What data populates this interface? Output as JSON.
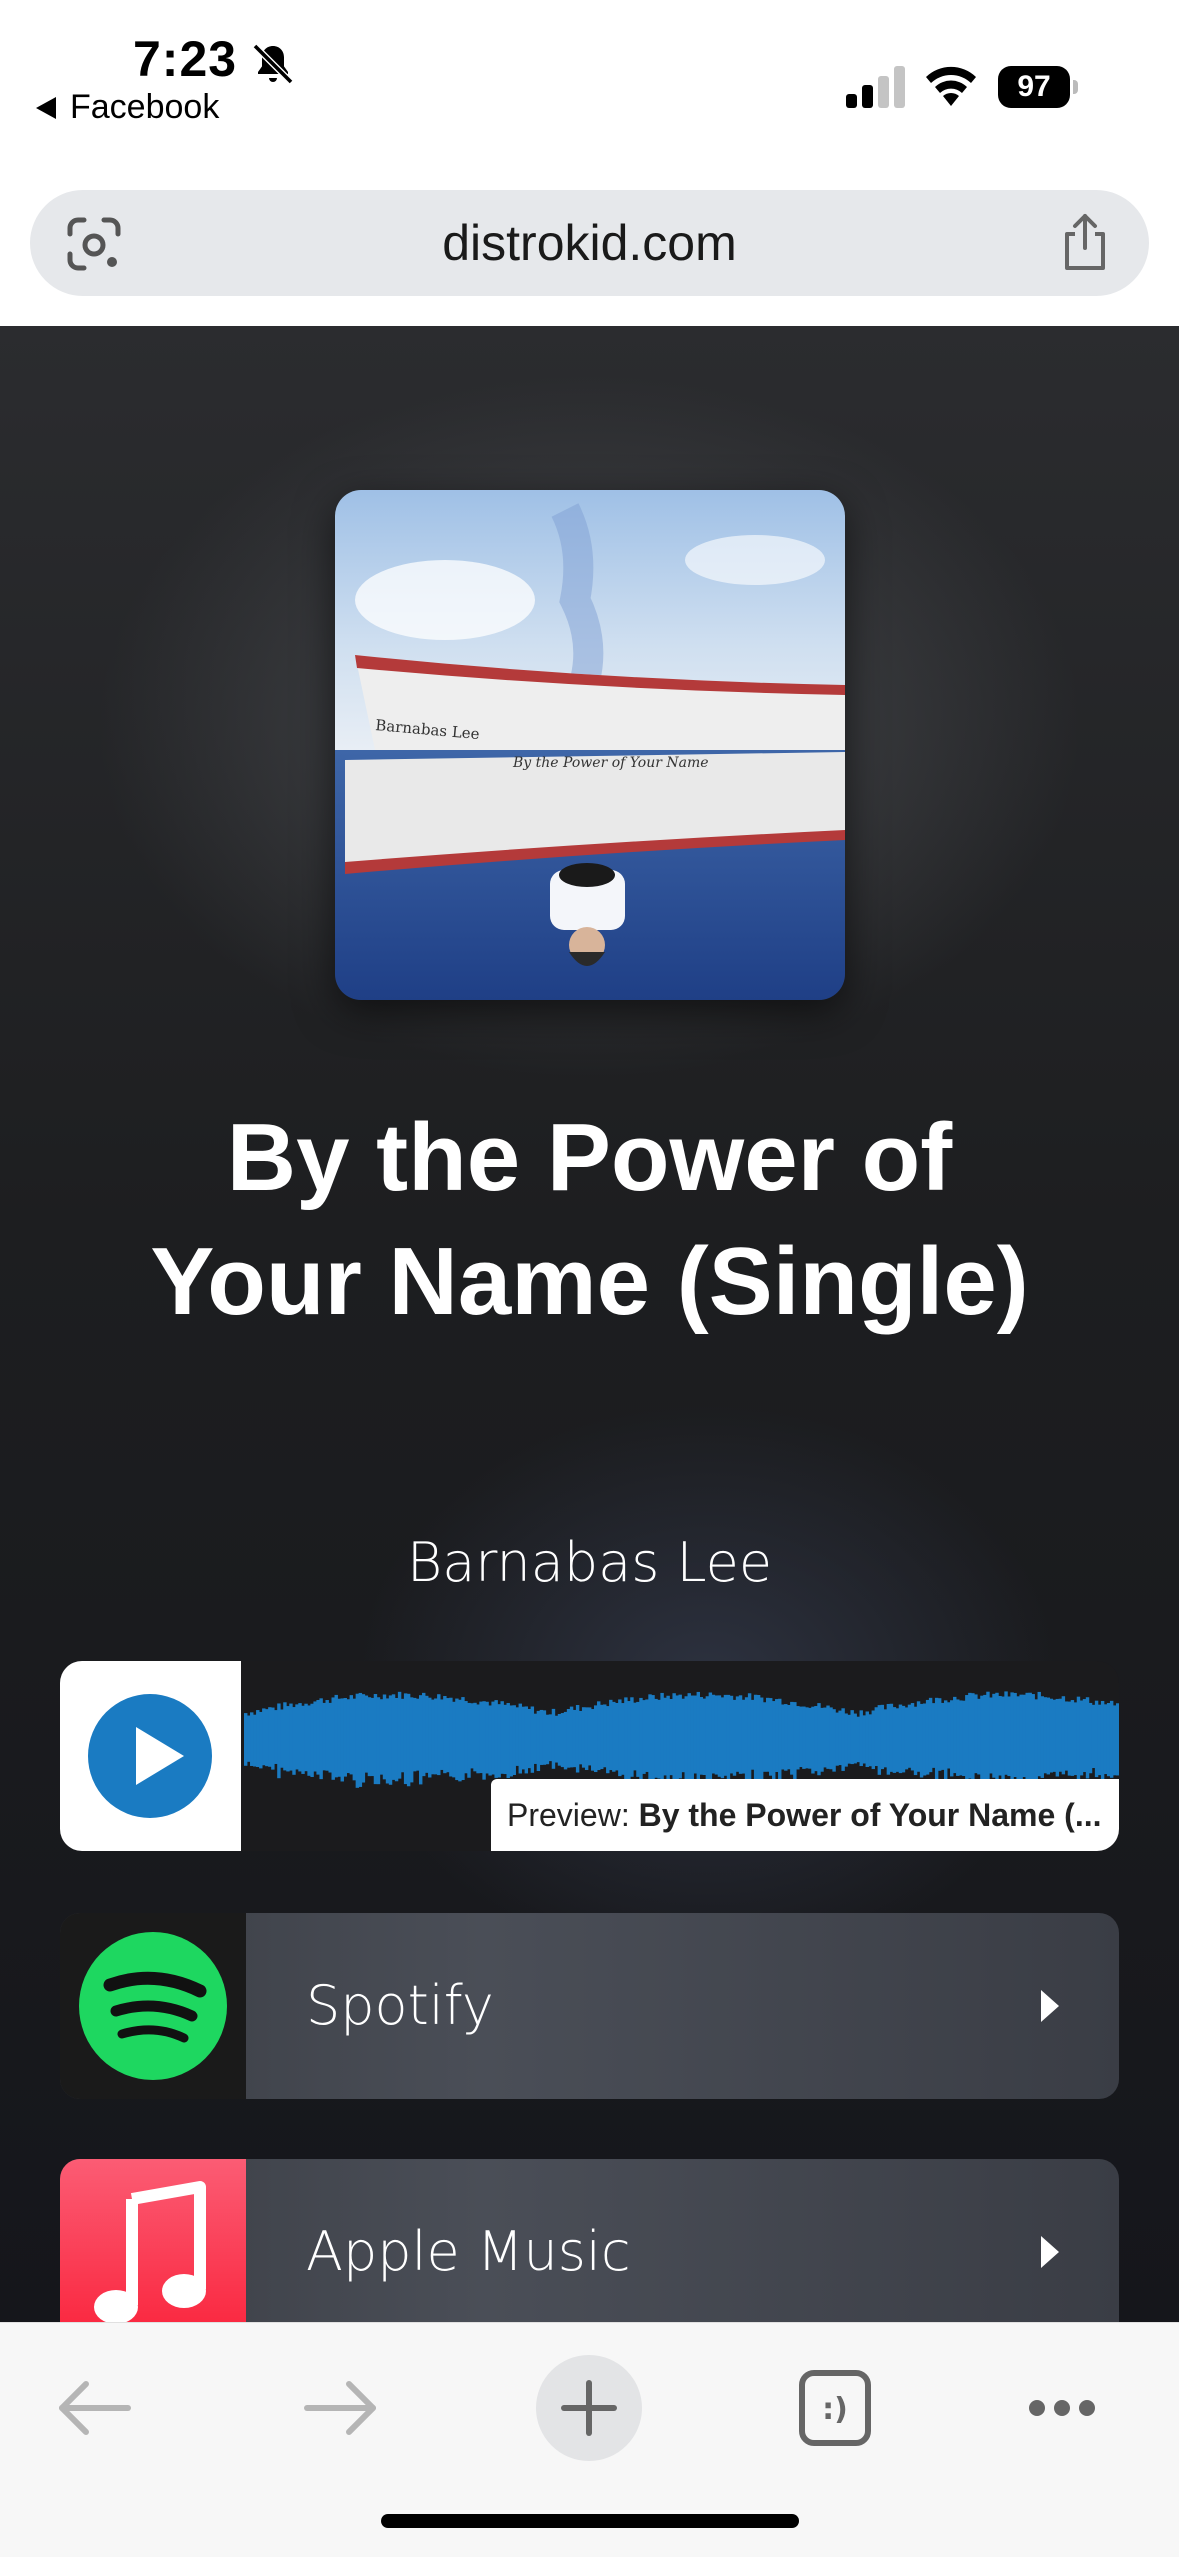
{
  "status_bar": {
    "time": "7:23",
    "back_app": "Facebook",
    "battery": "97"
  },
  "url_bar": {
    "url": "distrokid.com"
  },
  "release": {
    "title": "By the Power of Your Name (Single)",
    "artist": "Barnabas Lee",
    "cover_text_artist": "Barnabas Lee",
    "cover_text_title": "By the Power of Your Name"
  },
  "player": {
    "preview_prefix": "Preview:",
    "preview_title": "By the Power of Your Name (..."
  },
  "services": [
    {
      "label": "Spotify",
      "icon": "spotify-icon",
      "color": "#1ed760"
    },
    {
      "label": "Apple Music",
      "icon": "apple-music-icon",
      "color": "#fa2d48"
    }
  ],
  "toolbar": {
    "icons": [
      "back-arrow-icon",
      "forward-arrow-icon",
      "new-tab-icon",
      "tabs-icon",
      "more-icon"
    ]
  },
  "colors": {
    "play_blue": "#1a7bc2",
    "wave_blue": "#1a7bc2"
  }
}
